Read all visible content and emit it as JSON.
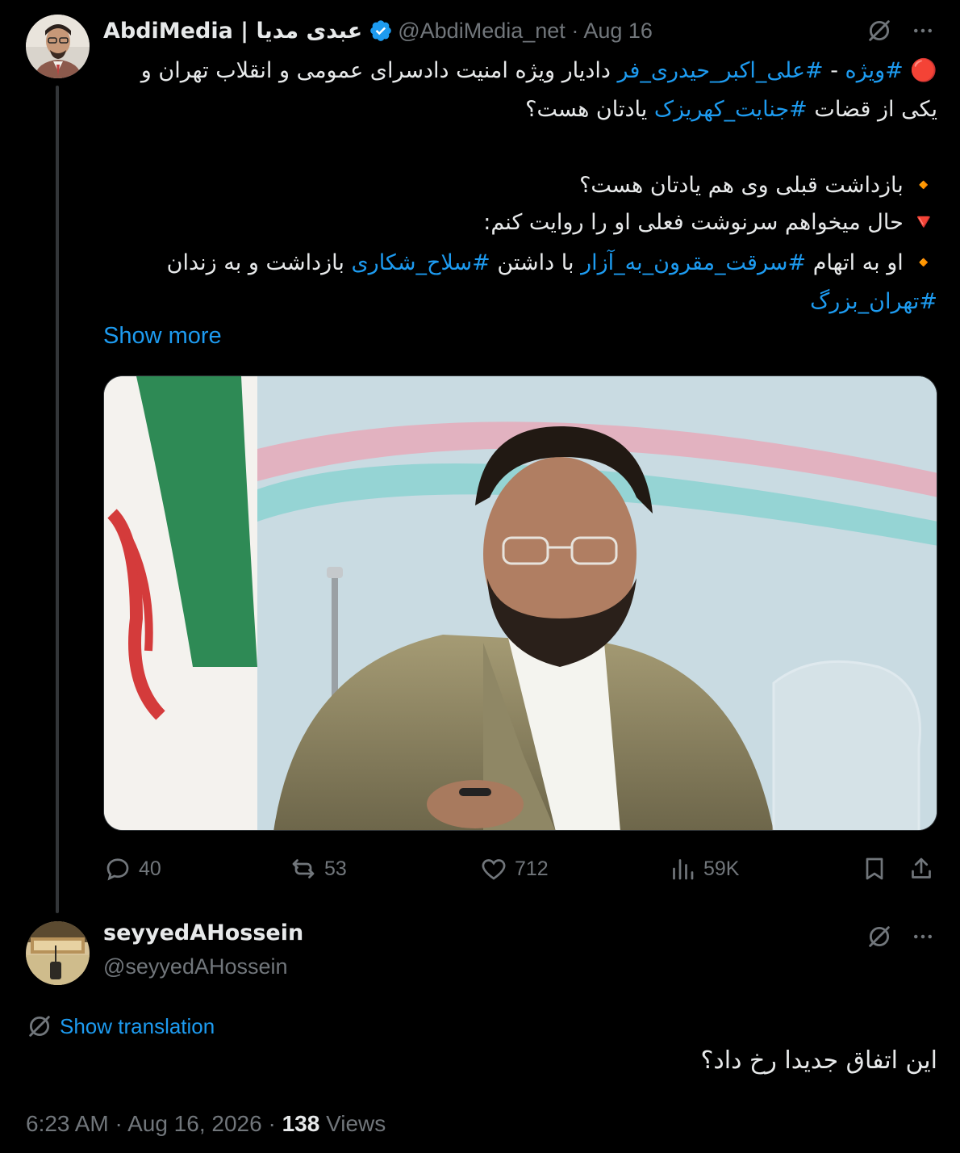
{
  "tweet": {
    "display_name": "AbdiMedia | عبدی مدیا",
    "handle": "@AbdiMedia_net",
    "separator": "·",
    "date": "Aug 16",
    "body": {
      "line1_prefix": "🔴",
      "line1_tag1": "#ویژه",
      "line1_dash": " - ",
      "line1_tag2": "#علی_اکبر_حیدری_فر",
      "line1_rest": " دادیار ویژه امنیت دادسرای عمومی و انقلاب تهران و",
      "line2_start": "یکی از قضات ",
      "line2_tag": "#جنایت_کهریزک",
      "line2_rest": " یادتان هست؟",
      "line3": "🔸 بازداشت قبلی وی هم یادتان هست؟",
      "line4": "🔻 حال میخواهم سرنوشت فعلی او را روایت کنم:",
      "line5_start": "🔸 او به اتهام ",
      "line5_tag1": "#سرقت_مقرون_به_آزار",
      "line5_mid": " با داشتن ",
      "line5_tag2": "#سلاح_شکاری",
      "line5_rest": " بازداشت و به زندان",
      "line6_tag": "#تهران_بزرگ"
    },
    "show_more": "Show more",
    "stats": {
      "replies": "40",
      "reposts": "53",
      "likes": "712",
      "views": "59K"
    }
  },
  "reply": {
    "display_name": "seyyedAHossein",
    "handle": "@seyyedAHossein",
    "show_translation": "Show translation",
    "text": "این اتفاق جدیدا رخ داد؟",
    "time": "6:23 AM",
    "date": "Aug 16, 2026",
    "views_count": "138",
    "views_label": "Views"
  },
  "icons": {
    "grok": "grok-icon",
    "more": "more-icon",
    "reply": "reply-icon",
    "repost": "repost-icon",
    "like": "heart-icon",
    "views": "views-icon",
    "bookmark": "bookmark-icon",
    "share": "share-icon",
    "verified": "verified-badge-icon",
    "translate": "translate-icon"
  },
  "colors": {
    "background": "#000000",
    "text": "#e7e9ea",
    "muted": "#71767b",
    "accent": "#1d9bf0"
  }
}
